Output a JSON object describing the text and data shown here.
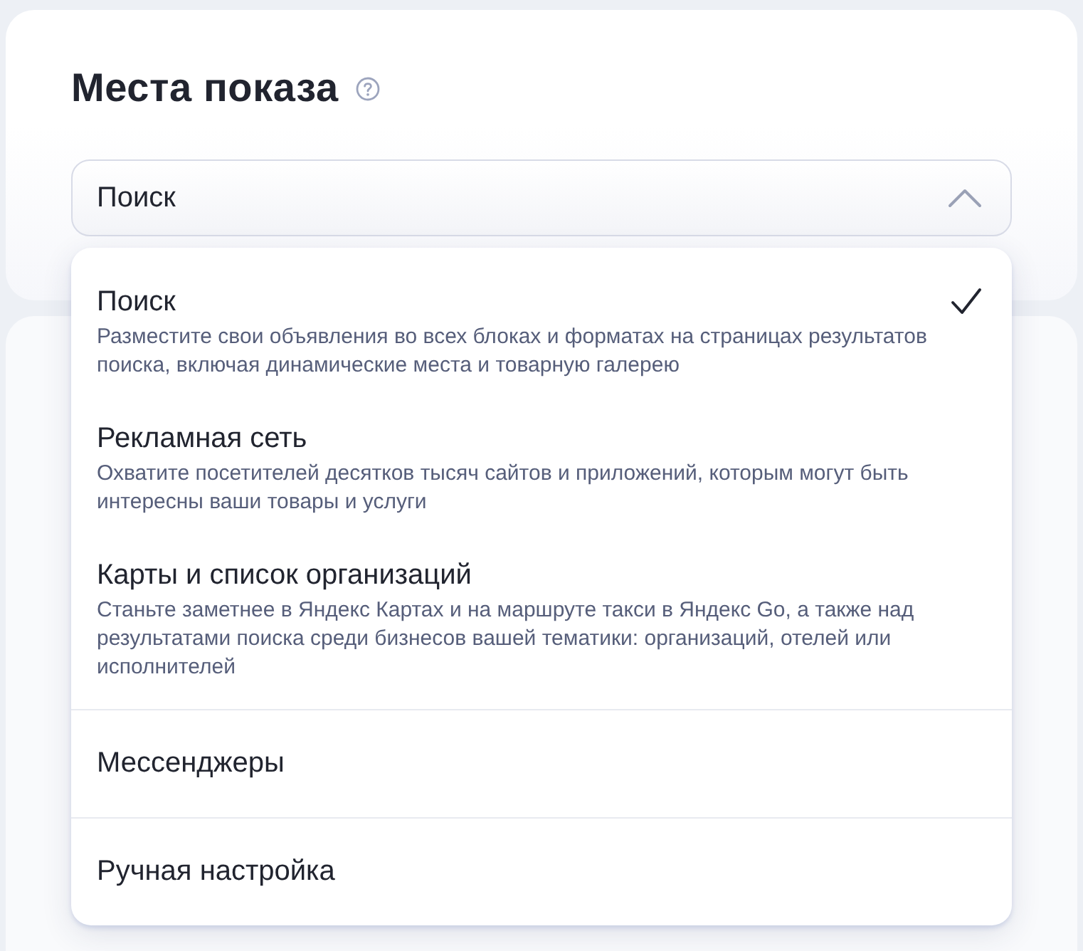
{
  "section": {
    "title": "Места показа"
  },
  "select": {
    "value": "Поиск",
    "expanded": true
  },
  "menu": {
    "items": [
      {
        "kind": "described",
        "title": "Поиск",
        "description": "Разместите свои объявления во всех блоках и форматах на страницах результатов поиска, включая динамические места и товарную галерею",
        "selected": true
      },
      {
        "kind": "described",
        "title": "Рекламная сеть",
        "description": "Охватите посетителей десятков тысяч сайтов и приложений, которым могут быть интересны ваши товары и услуги",
        "selected": false
      },
      {
        "kind": "described",
        "title": "Карты и список организаций",
        "description": "Станьте заметнее в Яндекс Картах и на маршруте такси в Яндекс Go, а также над результатами поиска среди бизнесов вашей тематики: организаций, отелей или исполнителей",
        "selected": false
      },
      {
        "kind": "plain",
        "title": "Мессенджеры",
        "selected": false
      },
      {
        "kind": "plain",
        "title": "Ручная настройка",
        "selected": false
      }
    ]
  }
}
